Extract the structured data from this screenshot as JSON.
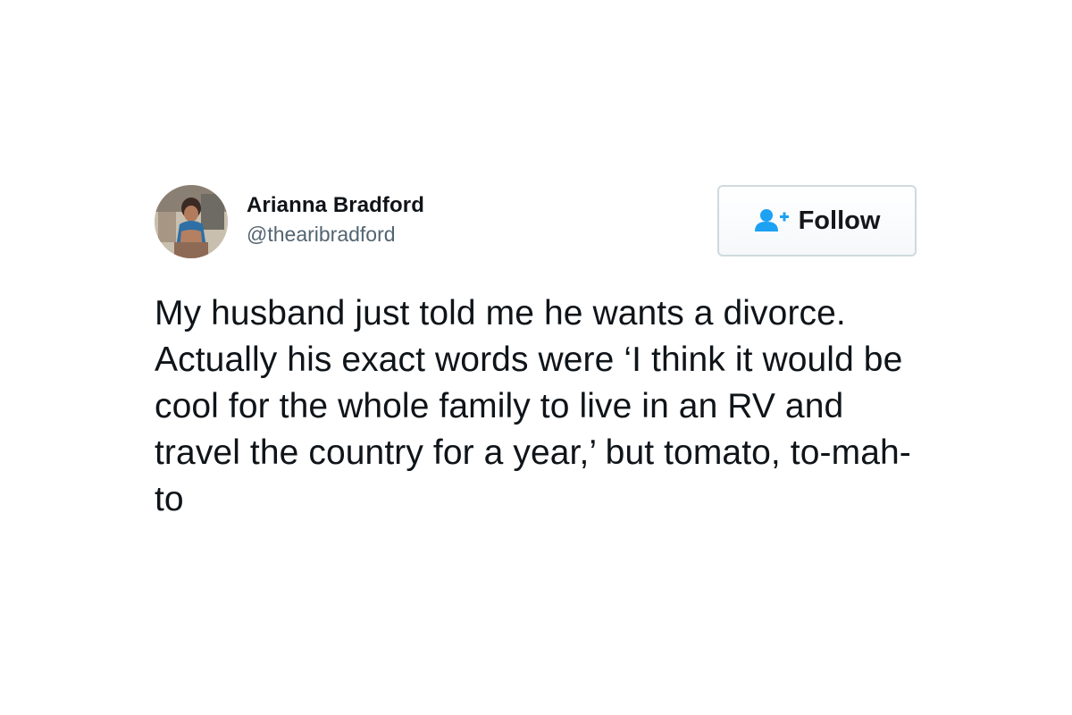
{
  "tweet": {
    "author": {
      "display_name": "Arianna Bradford",
      "handle": "@thearibradford"
    },
    "follow_button": {
      "label": "Follow",
      "icon": "add-user-icon",
      "accent_color": "#1da1f2"
    },
    "text": "My husband just told me he wants a divorce. Actually his exact words were ‘I think it would be cool for the whole family to live in an RV and travel the country for a year,’ but tomato, to-mah-to"
  }
}
